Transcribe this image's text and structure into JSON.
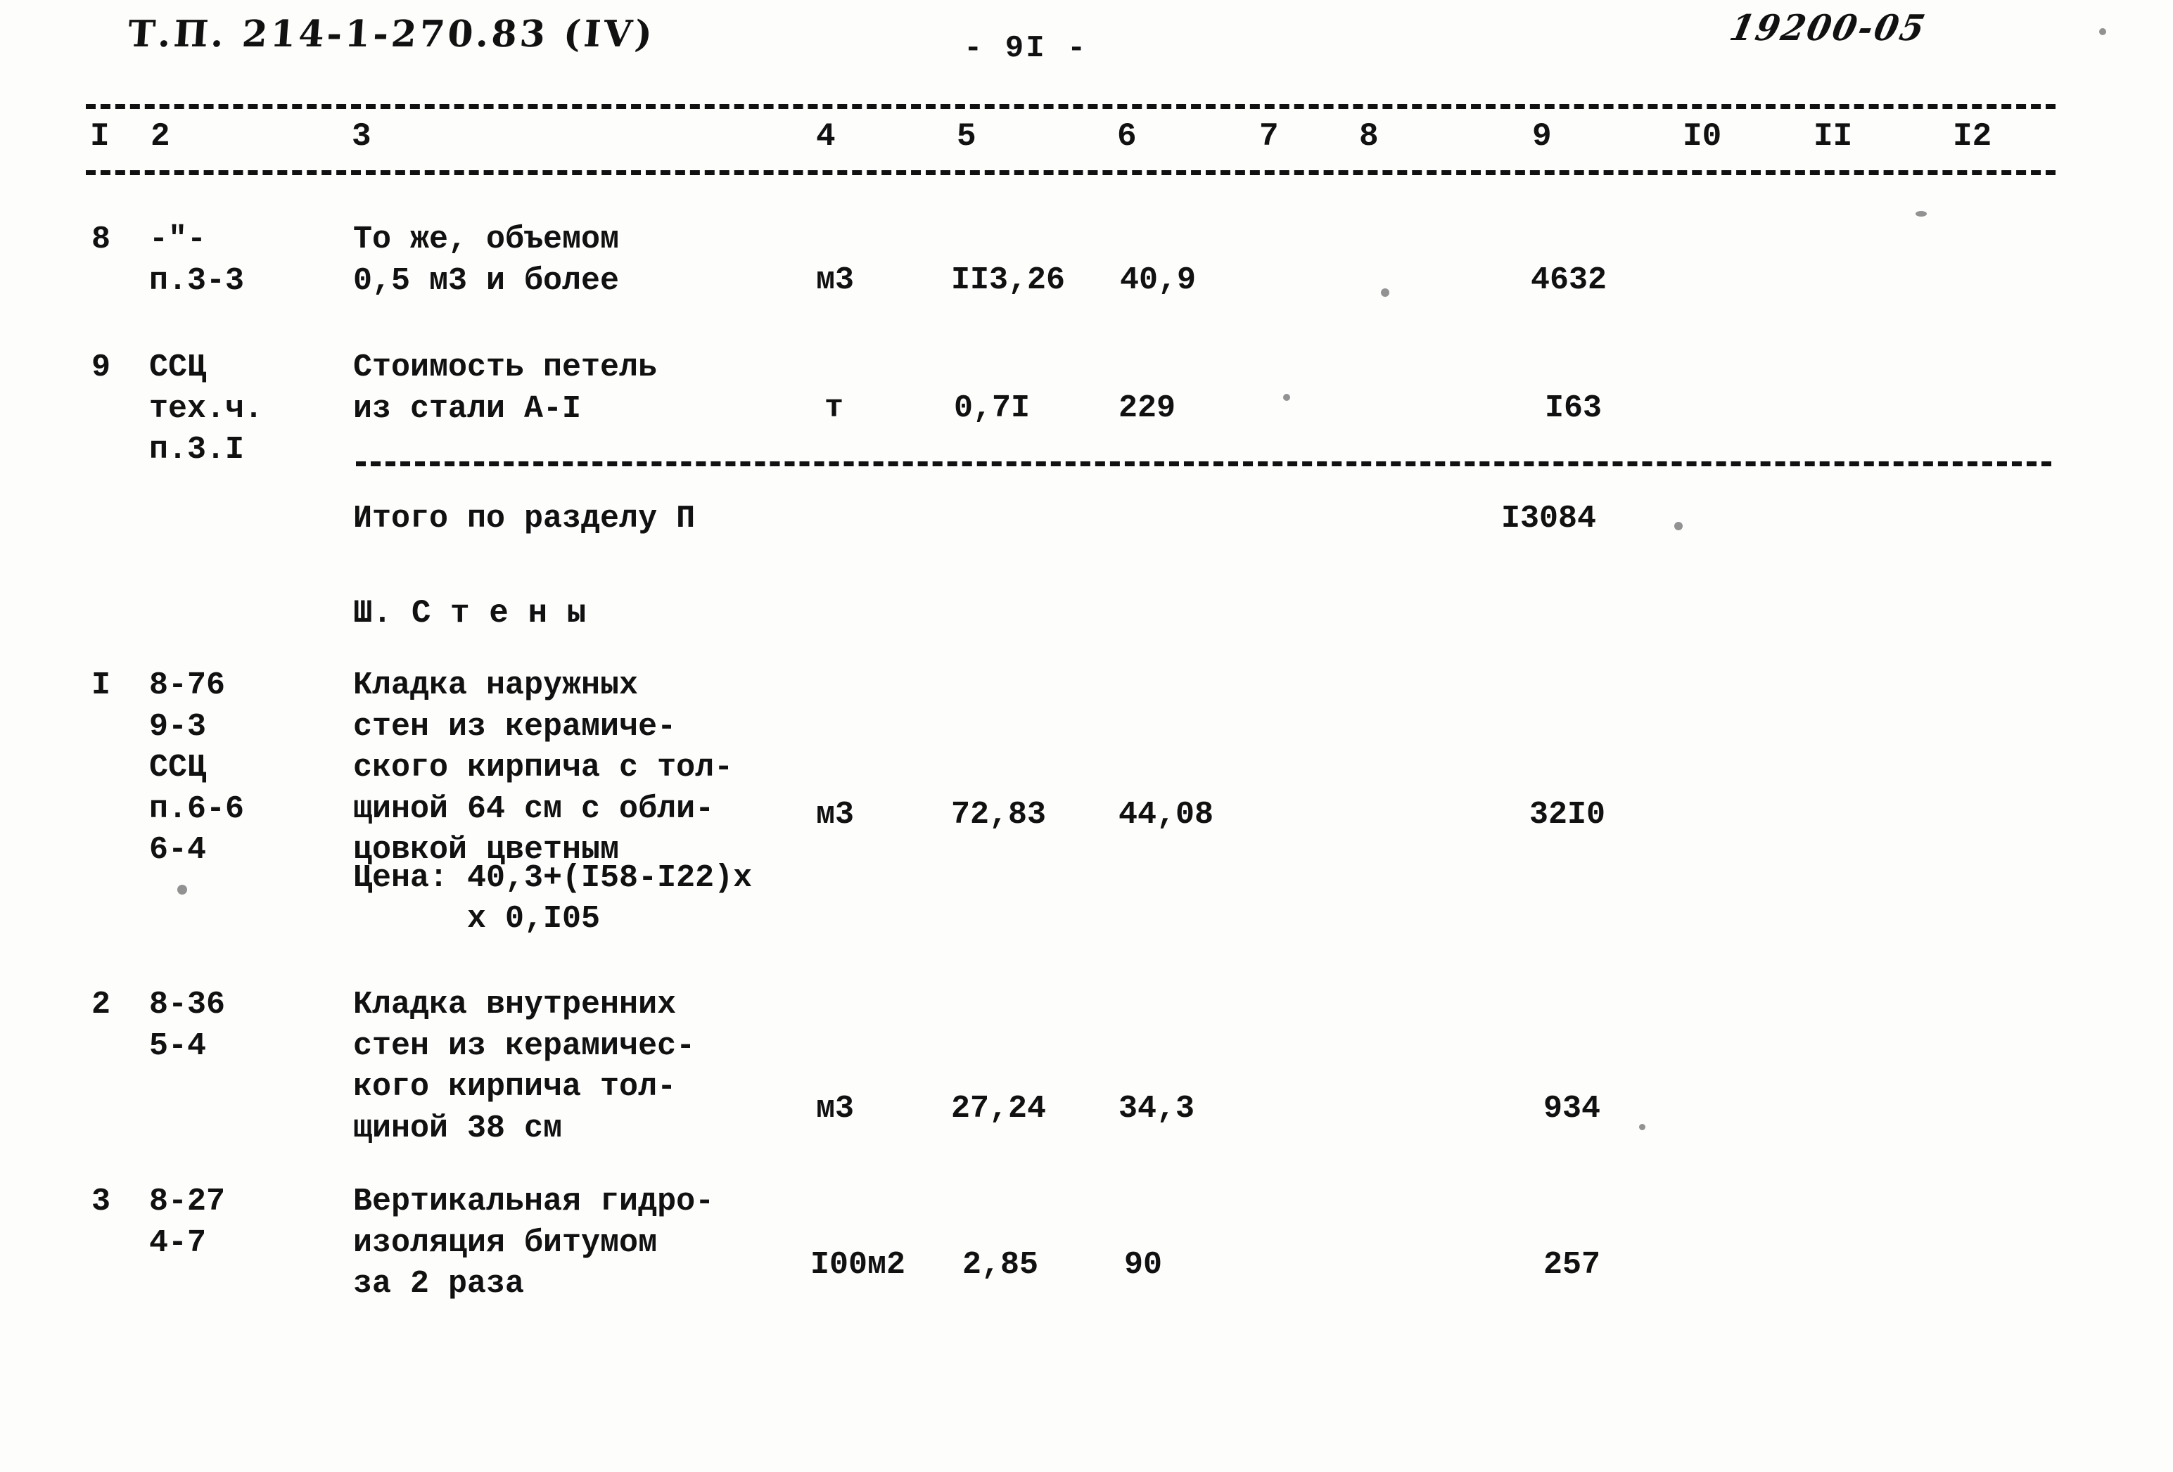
{
  "document": {
    "header_code": "Т.П. 214-1-270.83 (IV)",
    "page_number": "- 9I -",
    "stamp": "19200-05"
  },
  "table": {
    "column_headers": [
      "I",
      "2",
      "3",
      "4",
      "5",
      "6",
      "7",
      "8",
      "9",
      "I0",
      "II",
      "I2"
    ],
    "rows": [
      {
        "no": "8",
        "code": "-\"-\nп.3-3",
        "description": "То же, объемом\n0,5 м3 и более",
        "unit": "м3",
        "quantity": "II3,26",
        "price": "40,9",
        "col6": "",
        "col7": "",
        "total": "4632",
        "col10": "",
        "col11": "",
        "col12": ""
      },
      {
        "no": "9",
        "code": "ССЦ\nтех.ч.\nп.3.I",
        "description": "Стоимость петель\nиз стали А-I",
        "unit": "т",
        "quantity": "0,7I",
        "price": "229",
        "col6": "",
        "col7": "",
        "total": "I63",
        "col10": "",
        "col11": "",
        "col12": ""
      }
    ],
    "subtotal": {
      "label": "Итого по разделу П",
      "value": "I3084"
    },
    "section": {
      "title": "Ш. С т е н ы",
      "rows": [
        {
          "no": "I",
          "code": "8-76\n9-3\nССЦ\nп.6-6\n6-4",
          "description": "Кладка наружных\nстен из керамиче-\nского кирпича с тол-\nщиной 64 см с обли-\nцовкой цветным",
          "unit": "м3",
          "quantity": "72,83",
          "price": "44,08",
          "total": "32I0",
          "note": "Цена: 40,3+(I58-I22)х\n      х 0,I05"
        },
        {
          "no": "2",
          "code": "8-36\n5-4",
          "description": "Кладка внутренних\nстен из керамичес-\nкого кирпича тол-\nщиной 38 см",
          "unit": "м3",
          "quantity": "27,24",
          "price": "34,3",
          "total": "934",
          "note": ""
        },
        {
          "no": "3",
          "code": "8-27\n4-7",
          "description": "Вертикальная гидро-\nизоляция битумом\nза 2 раза",
          "unit": "I00м2",
          "quantity": "2,85",
          "price": "90",
          "total": "257",
          "note": ""
        }
      ]
    }
  }
}
